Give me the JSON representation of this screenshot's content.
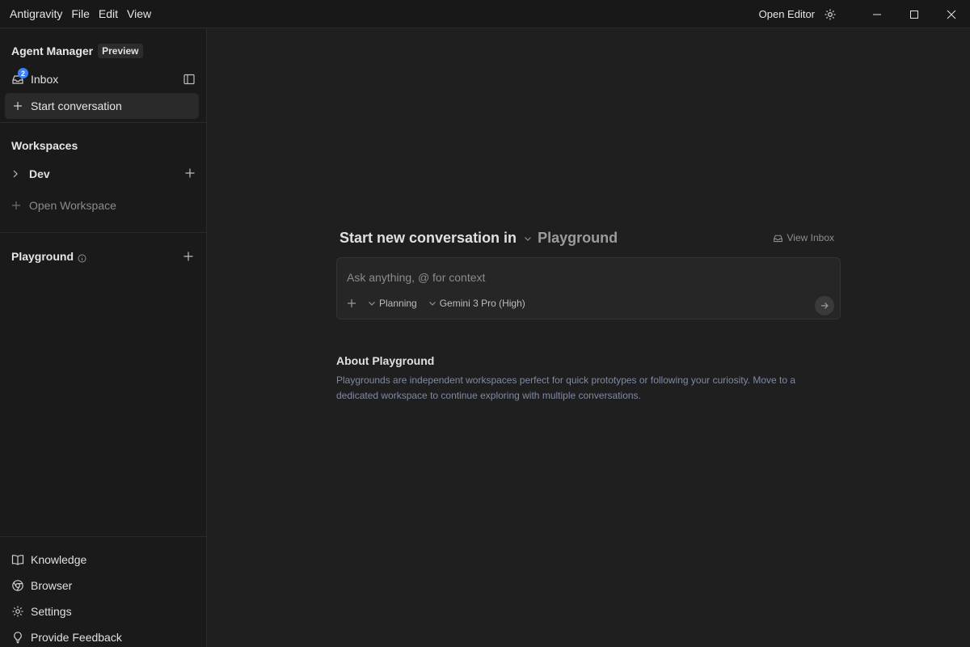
{
  "titlebar": {
    "app_name": "Antigravity",
    "menu": [
      "File",
      "Edit",
      "View"
    ],
    "open_editor_label": "Open Editor"
  },
  "sidebar": {
    "title": "Agent Manager",
    "badge": "Preview",
    "inbox": {
      "label": "Inbox",
      "count": "2"
    },
    "start_conversation_label": "Start conversation",
    "workspaces": {
      "title": "Workspaces",
      "items": [
        {
          "label": "Dev"
        }
      ],
      "open_workspace_label": "Open Workspace"
    },
    "playground_title": "Playground",
    "bottom_items": [
      {
        "label": "Knowledge",
        "icon": "book-icon"
      },
      {
        "label": "Browser",
        "icon": "browser-icon"
      },
      {
        "label": "Settings",
        "icon": "gear-icon"
      },
      {
        "label": "Provide Feedback",
        "icon": "lightbulb-icon"
      }
    ]
  },
  "main": {
    "heading": "Start new conversation in",
    "workspace_selected": "Playground",
    "view_inbox_label": "View Inbox",
    "input": {
      "placeholder": "Ask anything, @ for context",
      "mode_label": "Planning",
      "model_label": "Gemini 3 Pro (High)"
    },
    "about": {
      "title": "About Playground",
      "text": "Playgrounds are independent workspaces perfect for quick prototypes or following your curiosity. Move to a dedicated workspace to continue exploring with multiple conversations."
    }
  },
  "colors": {
    "background": "#1c1c1c",
    "sidebar": "#1a1a1a",
    "accent_badge": "#3b82f6",
    "muted_text": "#7f8aa3"
  }
}
